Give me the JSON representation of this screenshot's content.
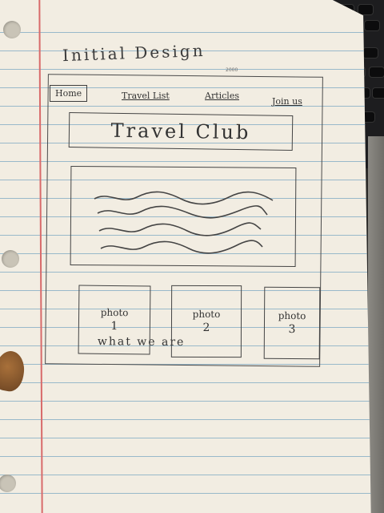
{
  "sketch": {
    "title": "Initial Design",
    "tiny_note": "2000",
    "nav": {
      "home": "Home",
      "travel_list": "Travel List",
      "articles": "Articles",
      "join_us": "Join us"
    },
    "banner": "Travel Club",
    "about_title": "what we are",
    "photos": [
      {
        "label": "photo",
        "number": "1"
      },
      {
        "label": "photo",
        "number": "2"
      },
      {
        "label": "photo",
        "number": "3"
      }
    ]
  },
  "colors": {
    "paper": "#f2ede2",
    "rule_lines": "#8fb3c8",
    "margin_line": "#d86a6a",
    "ink": "#3a3a3a"
  }
}
